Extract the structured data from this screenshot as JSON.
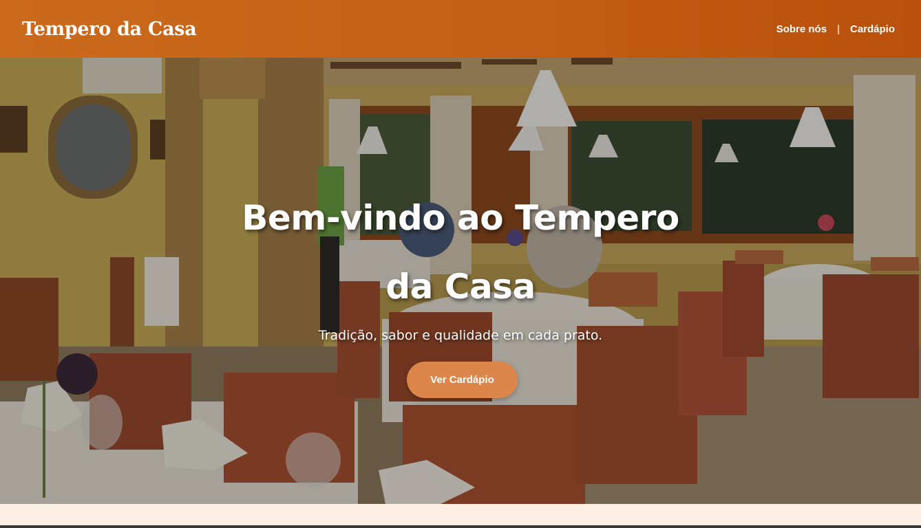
{
  "header": {
    "brand": "Tempero da Casa",
    "nav": {
      "about": "Sobre nós",
      "separator": "|",
      "menu": "Cardápio"
    }
  },
  "hero": {
    "title": "Bem-vindo ao Tempero da Casa",
    "subtitle": "Tradição, sabor e qualidade em cada prato.",
    "cta_label": "Ver Cardápio",
    "background_description_icon": "restaurant-interior-photo"
  },
  "colors": {
    "header_start": "#cb6a1c",
    "header_end": "#b9500c",
    "cta_button": "#dc864b",
    "page_background": "#fdf0e4",
    "text_on_dark": "#ffffff"
  }
}
